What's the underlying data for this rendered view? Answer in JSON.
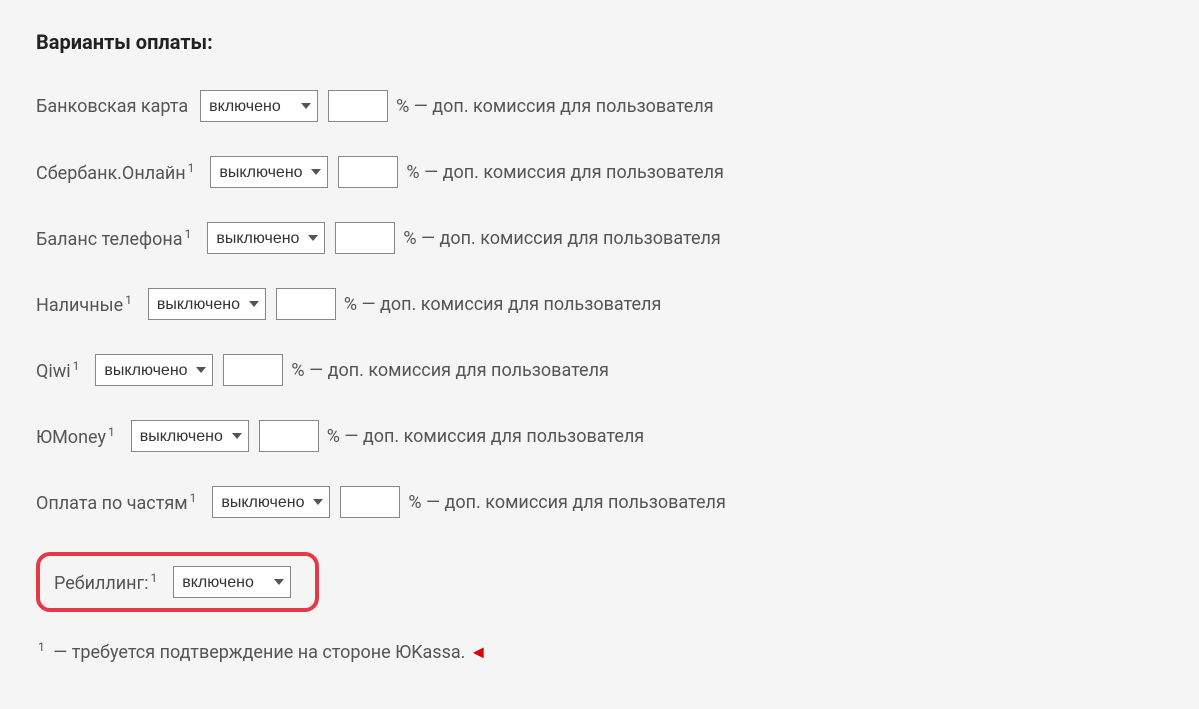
{
  "title": "Варианты оплаты:",
  "options": {
    "on": "включено",
    "off": "выключено"
  },
  "suffix": "% — доп. комиссия для пользователя",
  "rows": [
    {
      "label": "Банковская карта",
      "note": false,
      "selected": "включено"
    },
    {
      "label": "Сбербанк.Онлайн",
      "note": true,
      "selected": "выключено"
    },
    {
      "label": "Баланс телефона",
      "note": true,
      "selected": "выключено"
    },
    {
      "label": "Наличные",
      "note": true,
      "selected": "выключено"
    },
    {
      "label": "Qiwi",
      "note": true,
      "selected": "выключено"
    },
    {
      "label": "ЮMoney",
      "note": true,
      "selected": "выключено"
    },
    {
      "label": "Оплата по частям",
      "note": true,
      "selected": "выключено"
    }
  ],
  "rebilling": {
    "label": "Ребиллинг:",
    "note": true,
    "selected": "включено"
  },
  "footnote": {
    "sup": "1",
    "text": " — требуется подтверждение на стороне ЮKassa."
  }
}
